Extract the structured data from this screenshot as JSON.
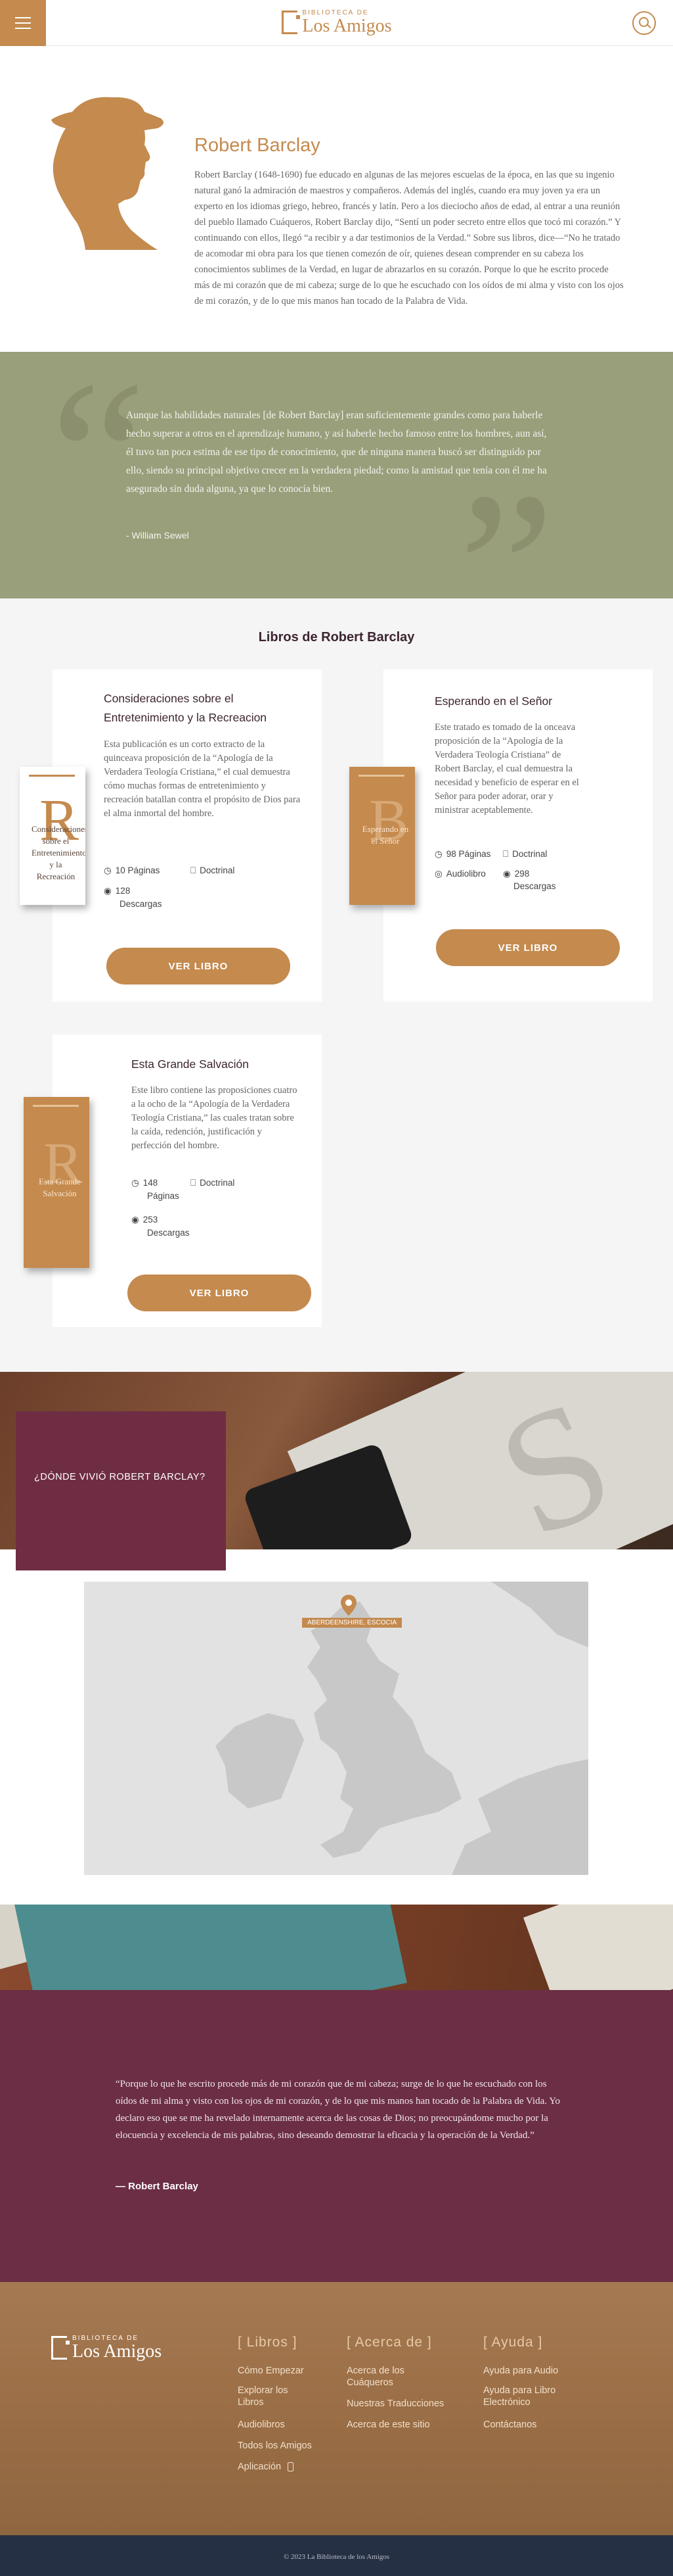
{
  "header": {
    "logo_small": "BIBLIOTECA DE",
    "logo_big": "Los Amigos"
  },
  "bio": {
    "name": "Robert Barclay",
    "text": "Robert Barclay (1648-1690) fue educado en algunas de las mejores escuelas de la época, en las que su ingenio natural ganó la admiración de maestros y compañeros. Además del inglés, cuando era muy joven ya era un experto en los idiomas griego, hebreo, francés y latín. Pero a los dieciocho años de edad, al entrar a una reunión del pueblo llamado Cuáqueros, Robert Barclay dijo, “Sentí un poder secreto entre ellos que tocó mi corazón.” Y continuando con ellos, llegó “a recibir y a dar testimonios de la Verdad.” Sobre sus libros, dice—“No he tratado de acomodar mi obra para los que tienen comezón de oír, quienes desean comprender en su cabeza los conocimientos sublimes de la Verdad, en lugar de abrazarlos en su corazón. Porque lo que he escrito procede más de mi corazón que de mi cabeza; surge de lo que he escuchado con los oídos de mi alma y visto con los ojos de mi corazón, y de lo que mis manos han tocado de la Palabra de Vida."
  },
  "quote1": {
    "text": "Aunque las habilidades naturales [de Robert Barclay] eran suficientemente grandes como para haberle hecho superar a otros en el aprendizaje humano, y así haberle hecho famoso entre los hombres, aun así, él tuvo tan poca estima de ese tipo de conocimiento, que de ninguna manera buscó ser distinguido por ello, siendo su principal objetivo crecer en la verdadera piedad; como la amistad que tenía con él me ha asegurado sin duda alguna, ya que lo conocía bien.",
    "author": "- William Sewel"
  },
  "books": {
    "title": "Libros de Robert Barclay",
    "items": [
      {
        "title": "Consideraciones sobre el Entretenimiento y la Recreacion",
        "description": "Esta publicación es un corto extracto de la quinceava proposición de la “Apología de la Verdadera Teología Cristiana,” el cual demuestra cómo muchas formas de entretenimiento y recreación batallan contra el propósito de Dios para el alma inmortal del hombre.",
        "pages": "10 Páginas",
        "category": "Doctrinal",
        "downloads_count": "128",
        "downloads_label": "Descargas",
        "button": "VER LIBRO",
        "cover_letter": "R",
        "cover_title": "Consideraciones sobre el Entretenimiento y la Recreación"
      },
      {
        "title": "Esperando en el Señor",
        "description": "Este tratado es tomado de la onceava proposición de la “Apología de la Verdadera Teología Cristiana” de Robert Barclay, el cual demuestra la necesidad y beneficio de esperar en el Señor para poder adorar, orar y ministrar aceptablemente.",
        "pages": "98 Páginas",
        "category": "Doctrinal",
        "audio": "Audiolibro",
        "downloads_count": "298",
        "downloads_label": "Descargas",
        "button": "VER LIBRO",
        "cover_letter": "B",
        "cover_title": "Esperando en el Señor"
      },
      {
        "title": "Esta Grande Salvación",
        "description": "Este libro contiene las proposiciones cuatro a la ocho de la “Apología de la Verdadera Teología Cristiana,” las cuales tratan sobre la caída, redención, justificación y perfección del hombre.",
        "pages_count": "148",
        "pages_label": "Páginas",
        "category": "Doctrinal",
        "downloads_count": "253",
        "downloads_label": "Descargas",
        "button": "VER LIBRO",
        "cover_letter": "R",
        "cover_title": "Esta Grande Salvación"
      }
    ]
  },
  "where": {
    "heading": "¿DÓNDE VIVIÓ ROBERT BARCLAY?",
    "map_label": "ABERDEENSHIRE, ESCOCIA"
  },
  "quote2": {
    "text": "“Porque lo que he escrito procede más de mi corazón que de mi cabeza; surge de lo que he escuchado con los oídos de mi alma y visto con los ojos de mi corazón, y de lo que mis manos han tocado de la Palabra de Vida. Yo declaro eso que se me ha revelado internamente acerca de las cosas de Dios; no preocupándome mucho por la elocuencia y excelencia de mis palabras, sino deseando demostrar la eficacia y la operación de la Verdad.”",
    "author": "— Robert Barclay"
  },
  "footer": {
    "logo_small": "BIBLIOTECA DE",
    "logo_big": "Los Amigos",
    "col1": {
      "heading": "[ Libros ]",
      "links": [
        "Cómo Empezar",
        "Explorar los Libros",
        "Audiolibros",
        "Todos los Amigos",
        "Aplicación"
      ]
    },
    "col2": {
      "heading": "[ Acerca de ]",
      "links": [
        "Acerca de los Cuáqueros",
        "Nuestras Traducciones",
        "Acerca de este sitio"
      ]
    },
    "col3": {
      "heading": "[ Ayuda ]",
      "links": [
        "Ayuda para Audio",
        "Ayuda para Libro Electrónico",
        "Contáctanos"
      ]
    },
    "copyright": "© 2023 La Biblioteca de los Amigos"
  },
  "colors": {
    "accent": "#c48a4e",
    "olive": "#999e7b",
    "maroon": "#6b2e45",
    "footer_dark": "#263044"
  }
}
